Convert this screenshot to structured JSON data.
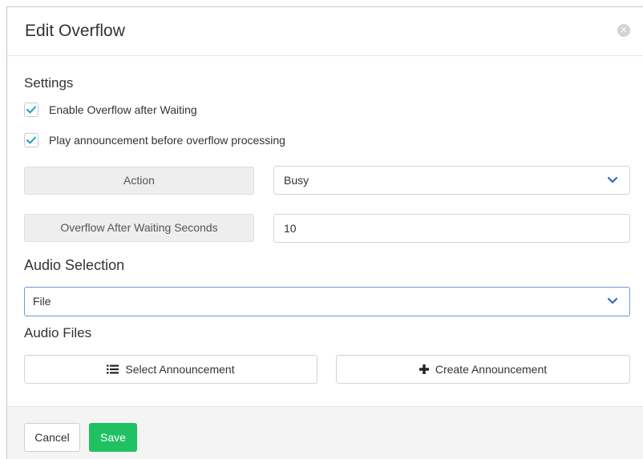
{
  "modal": {
    "title": "Edit Overflow",
    "close_icon": "close-circle-icon"
  },
  "settings": {
    "heading": "Settings",
    "enable_overflow": {
      "label": "Enable Overflow after Waiting",
      "checked": true
    },
    "play_announcement": {
      "label": "Play announcement before overflow processing",
      "checked": true
    },
    "action": {
      "label": "Action",
      "value": "Busy"
    },
    "overflow_wait": {
      "label": "Overflow After Waiting Seconds",
      "value": "10"
    }
  },
  "audio_selection": {
    "heading": "Audio Selection",
    "value": "File"
  },
  "audio_files": {
    "heading": "Audio Files",
    "select_label": "Select Announcement",
    "create_label": "Create Announcement"
  },
  "footer": {
    "cancel_label": "Cancel",
    "save_label": "Save"
  },
  "colors": {
    "accent_check": "#17a2b8",
    "save_green": "#1fc160",
    "select_focus_border": "#6c9bd2",
    "chevron_blue": "#2a6ebb"
  }
}
